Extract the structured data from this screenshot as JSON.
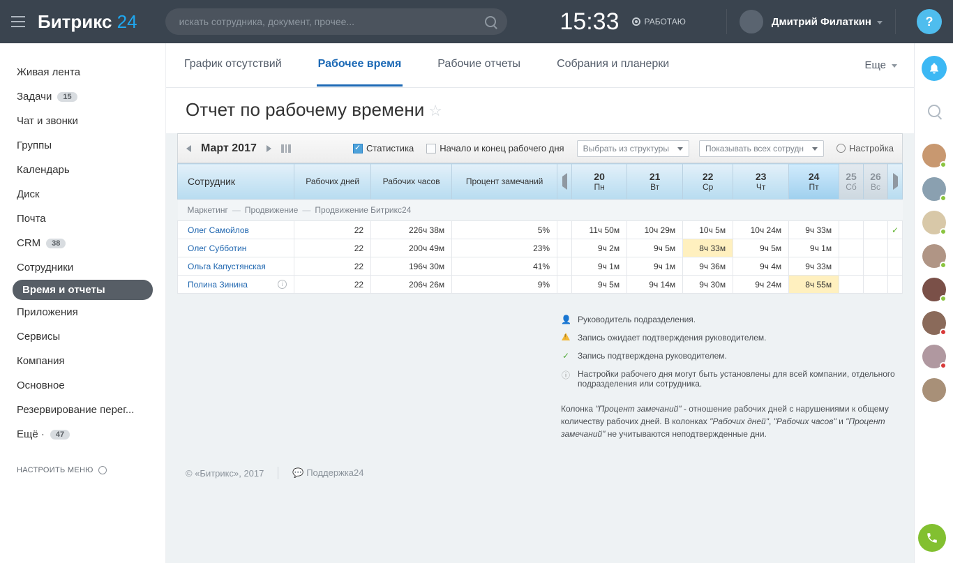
{
  "header": {
    "logo_main": "Битрикс",
    "logo_accent": "24",
    "search_placeholder": "искать сотрудника, документ, прочее...",
    "clock": "15:33",
    "work_status": "РАБОТАЮ",
    "username": "Дмитрий Филаткин",
    "help": "?"
  },
  "sidebar": {
    "items": [
      {
        "label": "Живая лента",
        "count": null
      },
      {
        "label": "Задачи",
        "count": "15"
      },
      {
        "label": "Чат и звонки",
        "count": null
      },
      {
        "label": "Группы",
        "count": null
      },
      {
        "label": "Календарь",
        "count": null
      },
      {
        "label": "Диск",
        "count": null
      },
      {
        "label": "Почта",
        "count": null
      },
      {
        "label": "CRM",
        "count": "38"
      },
      {
        "label": "Сотрудники",
        "count": null
      },
      {
        "label": "Время и отчеты",
        "count": null,
        "active": true
      },
      {
        "label": "Приложения",
        "count": null
      },
      {
        "label": "Сервисы",
        "count": null
      },
      {
        "label": "Компания",
        "count": null
      },
      {
        "label": "Основное",
        "count": null
      },
      {
        "label": "Резервирование перег...",
        "count": null
      },
      {
        "label": "Ещё ·",
        "count": "47"
      }
    ],
    "configure": "НАСТРОИТЬ МЕНЮ"
  },
  "tabs": {
    "items": [
      "График отсутствий",
      "Рабочее время",
      "Рабочие отчеты",
      "Собрания и планерки"
    ],
    "more": "Еще"
  },
  "page": {
    "title": "Отчет по рабочему времени"
  },
  "period_bar": {
    "period": "Март 2017",
    "stats_label": "Статистика",
    "day_bounds_label": "Начало и конец рабочего дня",
    "structure_select": "Выбрать из структуры",
    "show_select": "Показывать всех сотрудн",
    "settings": "Настройка"
  },
  "table": {
    "headers": {
      "employee": "Сотрудник",
      "workdays": "Рабочих дней",
      "workhours": "Рабочих часов",
      "remarks": "Процент замечаний"
    },
    "days": [
      {
        "num": "20",
        "dow": "Пн"
      },
      {
        "num": "21",
        "dow": "Вт"
      },
      {
        "num": "22",
        "dow": "Ср"
      },
      {
        "num": "23",
        "dow": "Чт"
      },
      {
        "num": "24",
        "dow": "Пт",
        "today": true
      },
      {
        "num": "25",
        "dow": "Сб",
        "weekend": true
      },
      {
        "num": "26",
        "dow": "Вс",
        "weekend": true
      }
    ],
    "breadcrumb": [
      "Маркетинг",
      "Продвижение",
      "Продвижение Битрикс24"
    ],
    "rows": [
      {
        "name": "Олег Самойлов",
        "days": "22",
        "hours": "226ч 38м",
        "remarks": "5%",
        "d": [
          "11ч 50м",
          "10ч 29м",
          "10ч 5м",
          "10ч 24м",
          "9ч 33м",
          "",
          ""
        ],
        "hl": [],
        "check": true
      },
      {
        "name": "Олег Субботин",
        "days": "22",
        "hours": "200ч 49м",
        "remarks": "23%",
        "d": [
          "9ч 2м",
          "9ч 5м",
          "8ч 33м",
          "9ч 5м",
          "9ч 1м",
          "",
          ""
        ],
        "hl": [
          2
        ]
      },
      {
        "name": "Ольга Капустянская",
        "days": "22",
        "hours": "196ч 30м",
        "remarks": "41%",
        "d": [
          "9ч 1м",
          "9ч 1м",
          "9ч 36м",
          "9ч 4м",
          "9ч 33м",
          "",
          ""
        ],
        "hl": []
      },
      {
        "name": "Полина Зинина",
        "days": "22",
        "hours": "206ч 26м",
        "remarks": "9%",
        "d": [
          "9ч 5м",
          "9ч 14м",
          "9ч 30м",
          "9ч 24м",
          "8ч 55м",
          "",
          ""
        ],
        "hl": [
          4
        ],
        "info": true
      }
    ]
  },
  "legend": {
    "rows": [
      "Руководитель подразделения.",
      "Запись ожидает подтверждения руководителем.",
      "Запись подтверждена руководителем.",
      "Настройки рабочего дня могут быть установлены для всей компании, отдельного подразделения или сотрудника."
    ],
    "note_1": "Колонка ",
    "note_em1": "\"Процент замечаний\"",
    "note_2": " - отношение рабочих дней с нарушениями к общему количеству рабочих дней. В колонках ",
    "note_em2": "\"Рабочих дней\"",
    "note_3": ", ",
    "note_em3": "\"Рабочих часов\"",
    "note_4": " и ",
    "note_em4": "\"Процент замечаний\"",
    "note_5": " не учитываются неподтвержденные дни."
  },
  "footer": {
    "copyright": "© «Битрикс», 2017",
    "support": "Поддержка24"
  }
}
